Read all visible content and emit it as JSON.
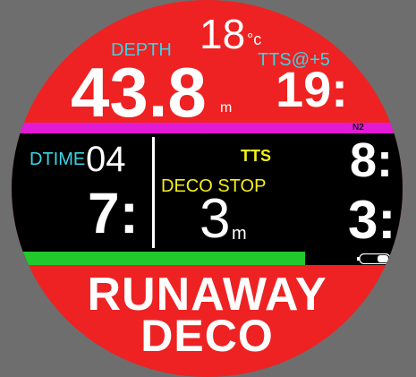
{
  "temperature": {
    "value": "18",
    "unit": "°c"
  },
  "depth": {
    "label": "DEPTH",
    "value": "43.8",
    "unit": "m"
  },
  "tts_plus5": {
    "label": "TTS@+5",
    "value": "19:"
  },
  "n2_label": "N2",
  "dtime": {
    "label": "DTIME",
    "seconds_value": "04",
    "minutes_value": "7:"
  },
  "tts": {
    "label": "TTS",
    "value": "8:"
  },
  "deco_stop": {
    "label": "DECO STOP",
    "depth": "3",
    "unit": "m",
    "time": "3:"
  },
  "tissue_bar": {
    "fill_fraction": 0.75,
    "color": "#21c92d"
  },
  "battery_icon": "battery-icon",
  "alarm": {
    "line1": "RUNAWAY",
    "line2": "DECO"
  },
  "colors": {
    "background": "#ee2222",
    "accent_cyan": "#39d4e6",
    "accent_yellow": "#f4f014",
    "n2_bar": "#e21ad6"
  }
}
